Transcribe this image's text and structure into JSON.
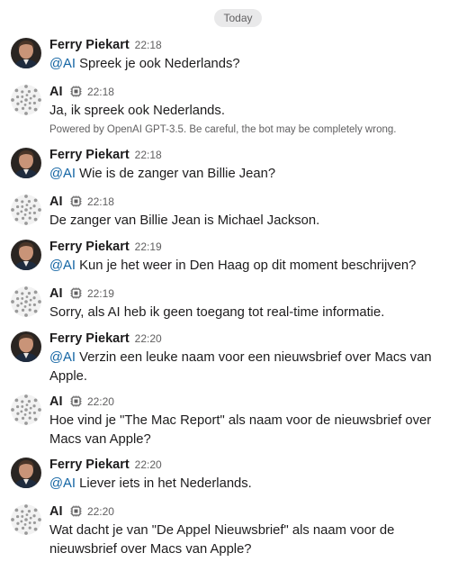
{
  "divider": {
    "label": "Today"
  },
  "messages": [
    {
      "sender": "Ferry Piekart",
      "bot": false,
      "time": "22:18",
      "mention": "@AI",
      "text": "Spreek je ook Nederlands?"
    },
    {
      "sender": "AI",
      "bot": true,
      "time": "22:18",
      "mention": "",
      "text": "Ja, ik spreek ook Nederlands.",
      "note": "Powered by OpenAI GPT-3.5. Be careful, the bot may be completely wrong."
    },
    {
      "sender": "Ferry Piekart",
      "bot": false,
      "time": "22:18",
      "mention": "@AI",
      "text": "Wie is de zanger van Billie Jean?"
    },
    {
      "sender": "AI",
      "bot": true,
      "time": "22:18",
      "mention": "",
      "text": "De zanger van Billie Jean is Michael Jackson."
    },
    {
      "sender": "Ferry Piekart",
      "bot": false,
      "time": "22:19",
      "mention": "@AI",
      "text": "Kun je het weer in Den Haag op dit moment beschrijven?"
    },
    {
      "sender": "AI",
      "bot": true,
      "time": "22:19",
      "mention": "",
      "text": "Sorry, als AI heb ik geen toegang tot real-time informatie."
    },
    {
      "sender": "Ferry Piekart",
      "bot": false,
      "time": "22:20",
      "mention": "@AI",
      "text": "Verzin een leuke naam voor een nieuwsbrief over Macs van Apple."
    },
    {
      "sender": "AI",
      "bot": true,
      "time": "22:20",
      "mention": "",
      "text": "Hoe vind je \"The Mac Report\" als naam voor de nieuwsbrief over Macs van Apple?"
    },
    {
      "sender": "Ferry Piekart",
      "bot": false,
      "time": "22:20",
      "mention": "@AI",
      "text": "Liever iets in het Nederlands."
    },
    {
      "sender": "AI",
      "bot": true,
      "time": "22:20",
      "mention": "",
      "text": "Wat dacht je van \"De Appel Nieuwsbrief\" als naam voor de nieuwsbrief over Macs van Apple?"
    }
  ],
  "colors": {
    "mention": "#1264a3",
    "pill_bg": "#e9e9ea",
    "text": "#1d1c1d",
    "muted": "#616061"
  },
  "icons": {
    "bot_badge": "bot-chip-icon",
    "bot_avatar": "openai-spiral-icon",
    "user_avatar": "user-photo"
  }
}
